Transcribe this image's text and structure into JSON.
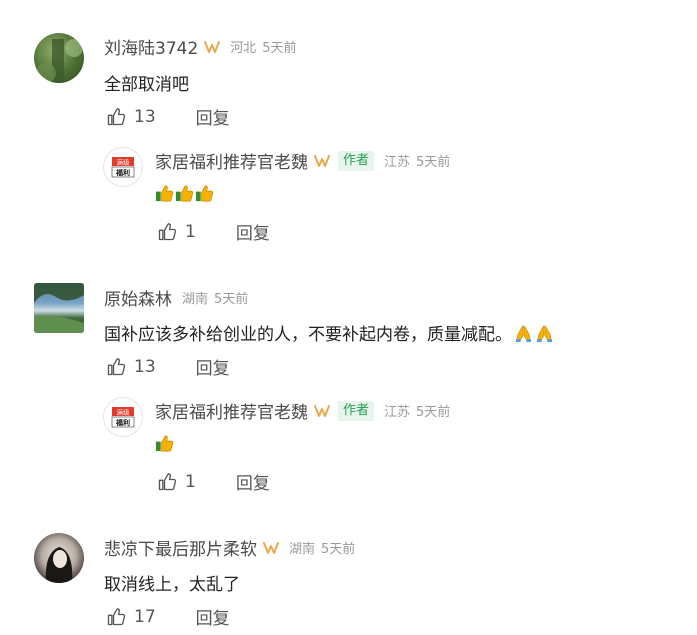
{
  "comments": [
    {
      "username": "刘海陆3742",
      "region": "河北",
      "time": "5天前",
      "text": "全部取消吧",
      "likes": "13",
      "reply_label": "回复",
      "reply": {
        "username": "家居福利推荐官老魏",
        "author_tag": "作者",
        "region": "江苏",
        "time": "5天前",
        "emoji": [
          "thumbs-up",
          "thumbs-up",
          "thumbs-up"
        ],
        "likes": "1",
        "reply_label": "回复"
      }
    },
    {
      "username": "原始森林",
      "region": "湖南",
      "time": "5天前",
      "text": "国补应该多补给创业的人，不要补起内卷，质量减配。",
      "trailing_emoji": [
        "folded-hands",
        "folded-hands"
      ],
      "likes": "13",
      "reply_label": "回复",
      "reply": {
        "username": "家居福利推荐官老魏",
        "author_tag": "作者",
        "region": "江苏",
        "time": "5天前",
        "emoji": [
          "thumbs-up"
        ],
        "likes": "1",
        "reply_label": "回复"
      }
    },
    {
      "username": "悲凉下最后那片柔软",
      "region": "湖南",
      "time": "5天前",
      "text": "取消线上，太乱了",
      "likes": "17",
      "reply_label": "回复"
    }
  ],
  "author_avatar_text": [
    "满级",
    "福利"
  ],
  "colors": {
    "author_tag_bg": "#e6f6ec",
    "author_tag_text": "#2a9d52",
    "badge": "#e8a94c",
    "meta_gray": "#9a9a9a"
  }
}
